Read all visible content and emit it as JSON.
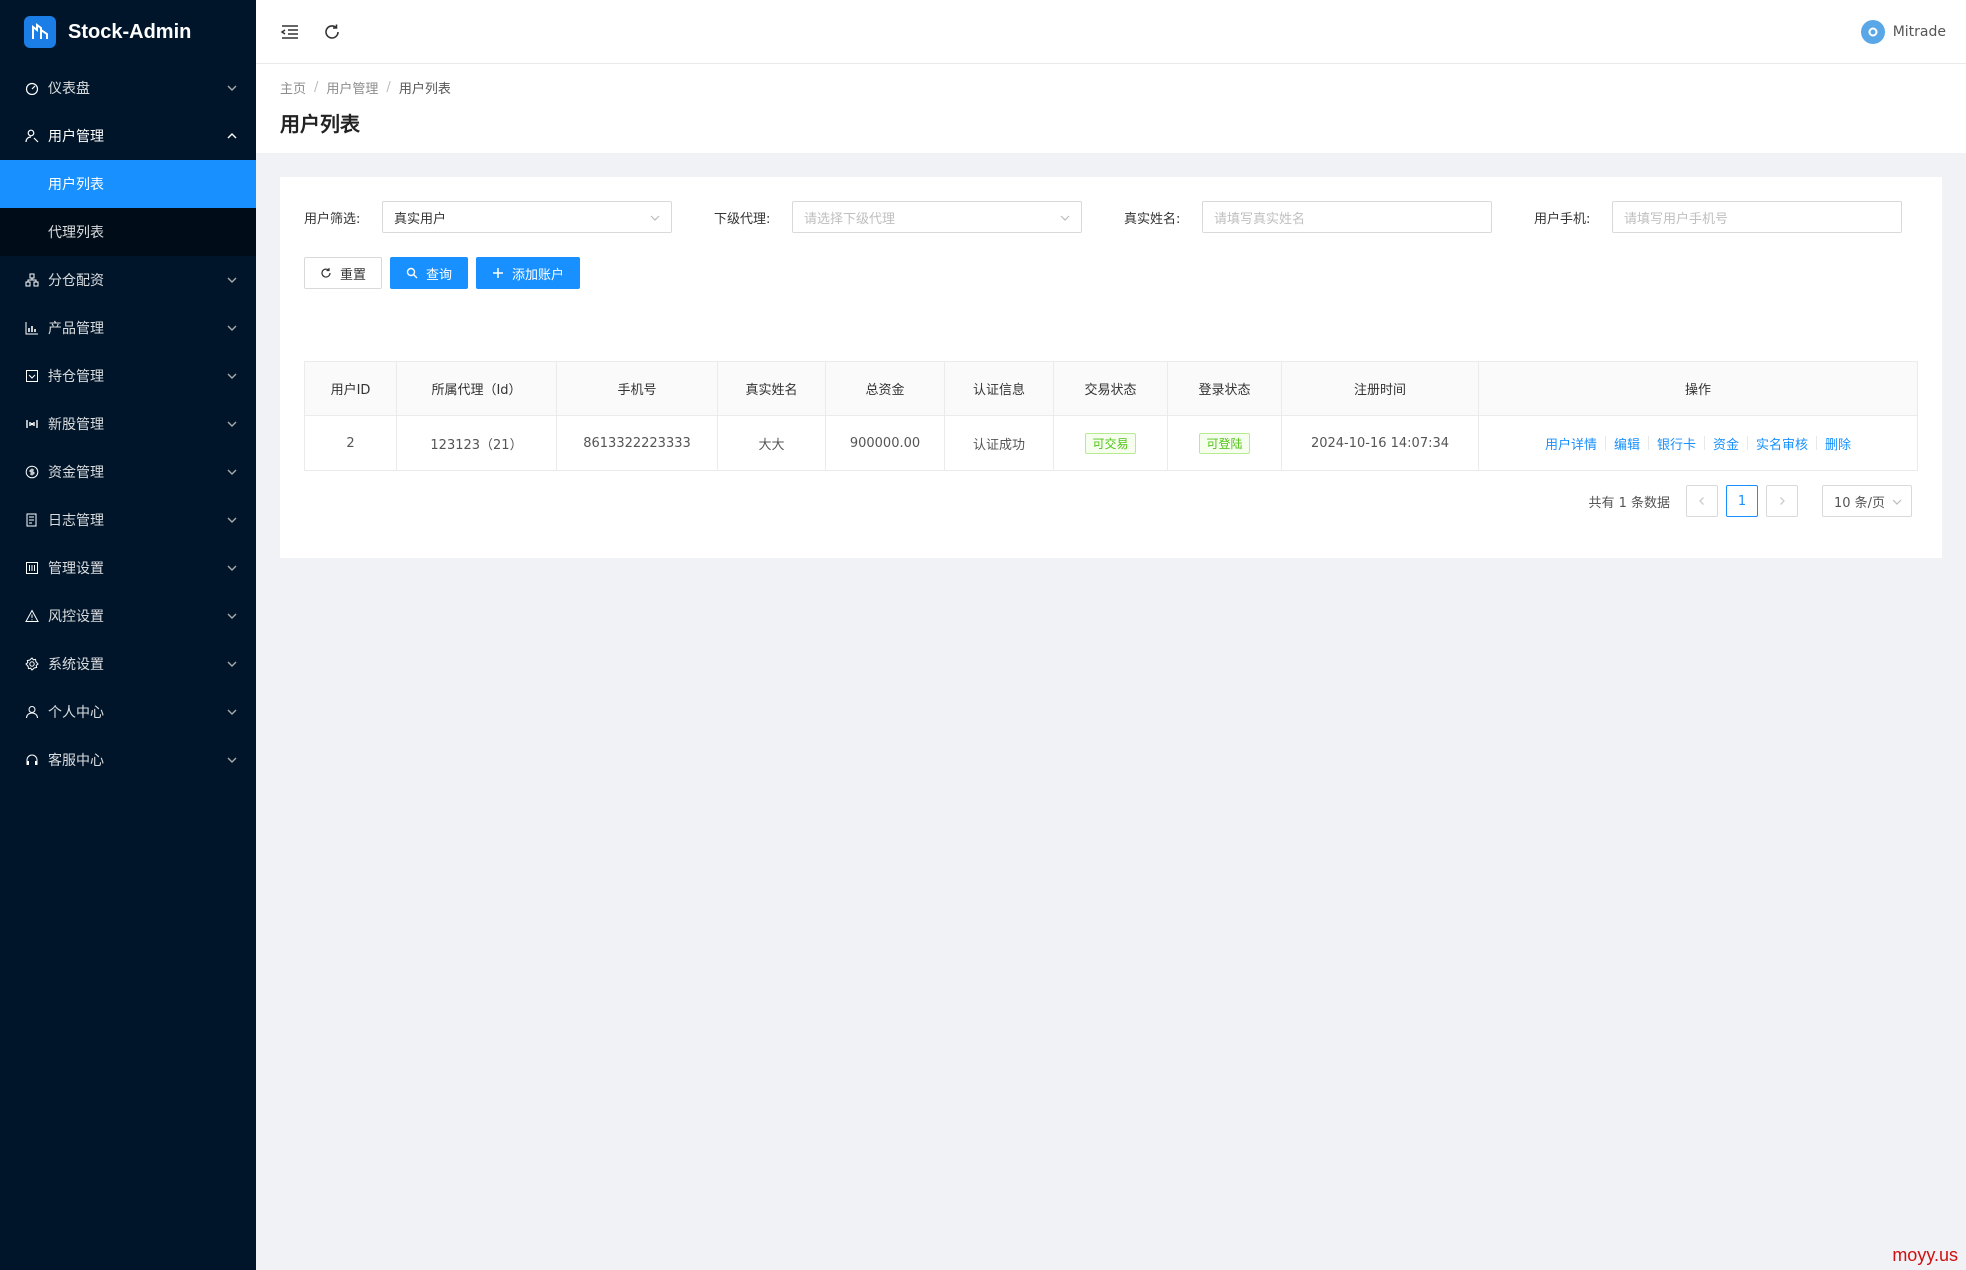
{
  "app": {
    "title": "Stock-Admin"
  },
  "header": {
    "user_name": "Mitrade"
  },
  "sidebar": {
    "items": [
      {
        "label": "仪表盘",
        "icon": "dashboard-icon"
      },
      {
        "label": "用户管理",
        "icon": "user-manage-icon",
        "expanded": true,
        "children": [
          {
            "label": "用户列表",
            "active": true
          },
          {
            "label": "代理列表"
          }
        ]
      },
      {
        "label": "分仓配资",
        "icon": "cluster-icon"
      },
      {
        "label": "产品管理",
        "icon": "chart-icon"
      },
      {
        "label": "持仓管理",
        "icon": "position-icon"
      },
      {
        "label": "新股管理",
        "icon": "ipo-icon"
      },
      {
        "label": "资金管理",
        "icon": "money-icon"
      },
      {
        "label": "日志管理",
        "icon": "log-icon"
      },
      {
        "label": "管理设置",
        "icon": "admin-settings-icon"
      },
      {
        "label": "风控设置",
        "icon": "warning-icon"
      },
      {
        "label": "系统设置",
        "icon": "gear-icon"
      },
      {
        "label": "个人中心",
        "icon": "person-icon"
      },
      {
        "label": "客服中心",
        "icon": "headset-icon"
      }
    ]
  },
  "breadcrumb": [
    "主页",
    "用户管理",
    "用户列表"
  ],
  "page_title": "用户列表",
  "filters": {
    "user_filter": {
      "label": "用户筛选:",
      "value": "真实用户"
    },
    "sub_agent": {
      "label": "下级代理:",
      "placeholder": "请选择下级代理"
    },
    "real_name": {
      "label": "真实姓名:",
      "placeholder": "请填写真实姓名"
    },
    "phone": {
      "label": "用户手机:",
      "placeholder": "请填写用户手机号"
    }
  },
  "buttons": {
    "reset": "重置",
    "search": "查询",
    "add": "添加账户"
  },
  "table": {
    "columns": [
      "用户ID",
      "所属代理（Id）",
      "手机号",
      "真实姓名",
      "总资金",
      "认证信息",
      "交易状态",
      "登录状态",
      "注册时间",
      "操作"
    ],
    "rows": [
      {
        "id": "2",
        "agent": "123123（21）",
        "phone": "8613322223333",
        "name": "大大",
        "funds": "900000.00",
        "auth": "认证成功",
        "trade_status": "可交易",
        "login_status": "可登陆",
        "reg_time": "2024-10-16 14:07:34",
        "ops": [
          "用户详情",
          "编辑",
          "银行卡",
          "资金",
          "实名审核",
          "删除"
        ]
      }
    ]
  },
  "pagination": {
    "total_text": "共有 1 条数据",
    "current_page": "1",
    "page_size": "10 条/页"
  },
  "watermark": "moyy.us",
  "colors": {
    "sidebar_bg": "#001529",
    "primary": "#1890ff",
    "success": "#52c41a",
    "watermark": "#d01010"
  }
}
